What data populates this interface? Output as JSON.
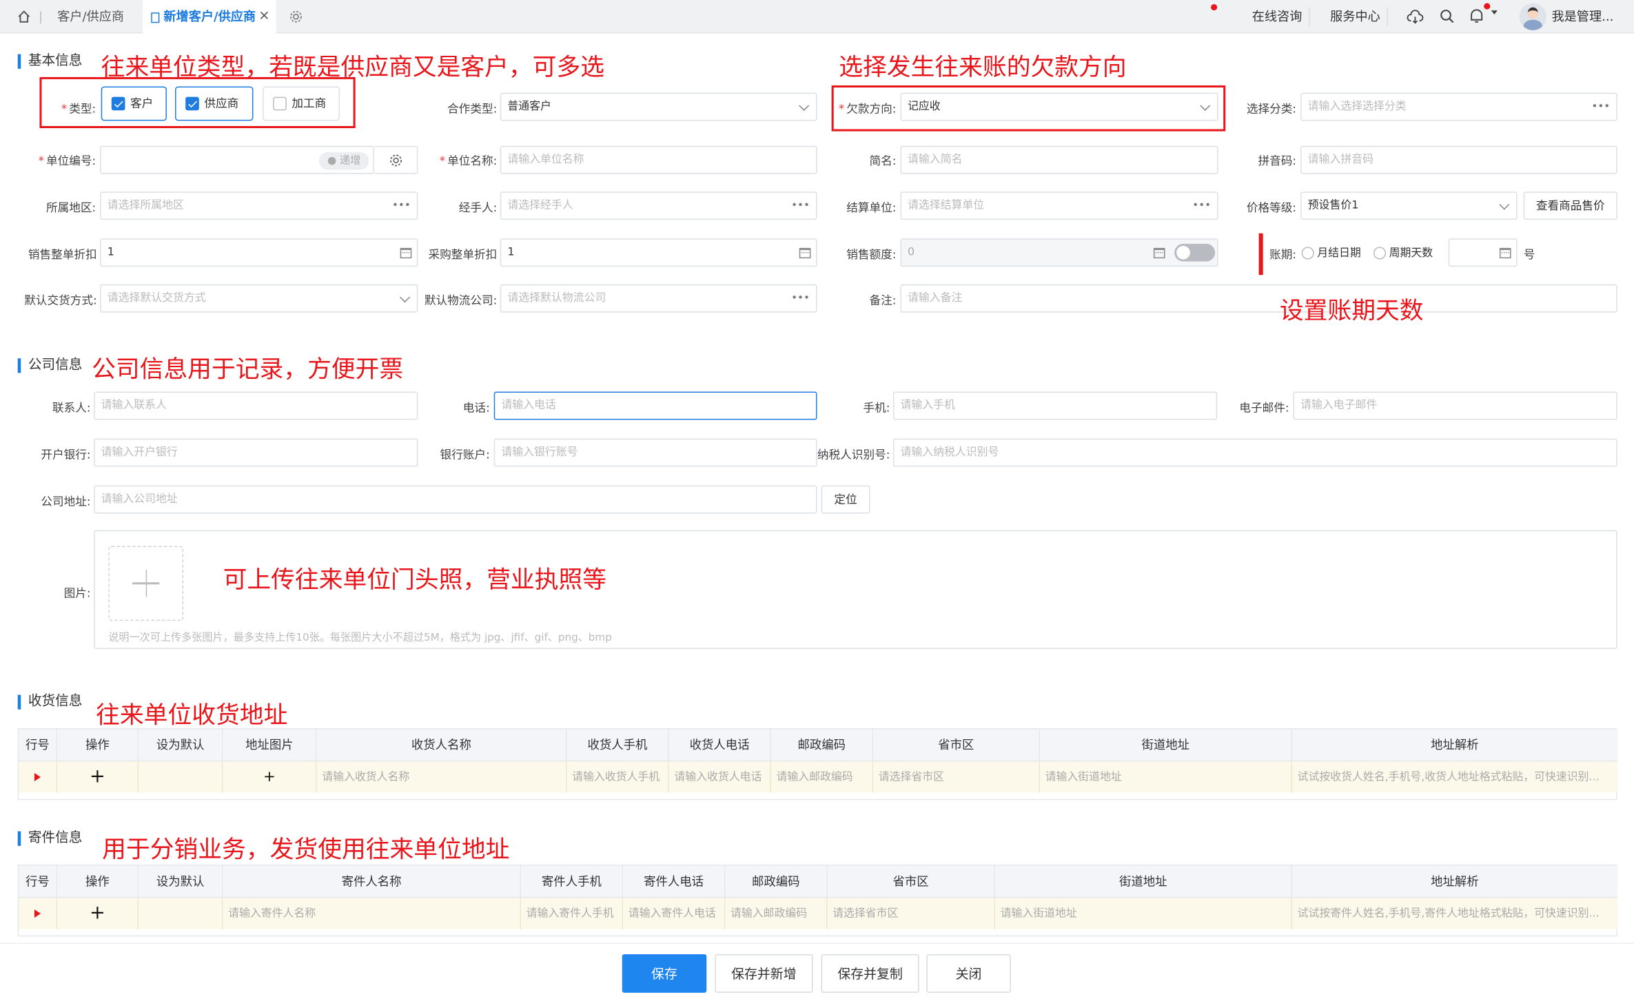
{
  "tabs": {
    "home_icon": "home-icon",
    "list": "客户/供应商",
    "active": "新增客户/供应商",
    "close": "×",
    "settings_icon": "gear-icon"
  },
  "header": {
    "online": "在线咨询",
    "service": "服务中心",
    "user": "我是管理..."
  },
  "basic": {
    "title": "基本信息",
    "type_label": "类型:",
    "type_options": [
      {
        "label": "客户",
        "checked": true
      },
      {
        "label": "供应商",
        "checked": true
      },
      {
        "label": "加工商",
        "checked": false
      }
    ],
    "coop_label": "合作类型:",
    "coop_value": "普通客户",
    "debt_label": "欠款方向:",
    "debt_value": "记应收",
    "cat_label": "选择分类:",
    "cat_ph": "请输入选择选择分类",
    "code_label": "单位编号:",
    "code_badge": "递增",
    "name_label": "单位名称:",
    "name_ph": "请输入单位名称",
    "short_label": "简名:",
    "short_ph": "请输入简名",
    "pinyin_label": "拼音码:",
    "pinyin_ph": "请输入拼音码",
    "region_label": "所属地区:",
    "region_ph": "请选择所属地区",
    "handler_label": "经手人:",
    "handler_ph": "请选择经手人",
    "settle_label": "结算单位:",
    "settle_ph": "请选择结算单位",
    "price_label": "价格等级:",
    "price_value": "预设售价1",
    "price_btn": "查看商品售价",
    "sale_disc_label": "销售整单折扣",
    "sale_disc_value": "1",
    "buy_disc_label": "采购整单折扣",
    "buy_disc_value": "1",
    "quota_label": "销售额度:",
    "quota_value": "0",
    "term_label": "账期:",
    "term_opt1": "月结日期",
    "term_opt2": "周期天数",
    "term_unit": "号",
    "delivery_label": "默认交货方式:",
    "delivery_ph": "请选择默认交货方式",
    "logistics_label": "默认物流公司:",
    "logistics_ph": "请选择默认物流公司",
    "remark_label": "备注:",
    "remark_ph": "请输入备注"
  },
  "company": {
    "title": "公司信息",
    "contact_label": "联系人:",
    "contact_ph": "请输入联系人",
    "phone_label": "电话:",
    "phone_ph": "请输入电话",
    "mobile_label": "手机:",
    "mobile_ph": "请输入手机",
    "email_label": "电子邮件:",
    "email_ph": "请输入电子邮件",
    "bank_label": "开户银行:",
    "bank_ph": "请输入开户银行",
    "account_label": "银行账户:",
    "account_ph": "请输入银行账号",
    "tax_label": "纳税人识别号:",
    "tax_ph": "请输入纳税人识别号",
    "addr_label": "公司地址:",
    "addr_ph": "请输入公司地址",
    "locate_btn": "定位",
    "image_label": "图片:",
    "image_note": "说明一次可上传多张图片，最多支持上传10张。每张图片大小不超过5M，格式为 jpg、jfif、gif、png、bmp"
  },
  "receive": {
    "title": "收货信息",
    "headers": [
      "行号",
      "操作",
      "设为默认",
      "地址图片",
      "收货人名称",
      "收货人手机",
      "收货人电话",
      "邮政编码",
      "省市区",
      "街道地址",
      "地址解析"
    ],
    "row": [
      "",
      "+",
      "",
      "+",
      "请输入收货人名称",
      "请输入收货人手机",
      "请输入收货人电话",
      "请输入邮政编码",
      "请选择省市区",
      "请输入街道地址",
      "试试按收货人姓名,手机号,收货人地址格式粘贴，可快速识别..."
    ]
  },
  "send": {
    "title": "寄件信息",
    "headers": [
      "行号",
      "操作",
      "设为默认",
      "寄件人名称",
      "寄件人手机",
      "寄件人电话",
      "邮政编码",
      "省市区",
      "街道地址",
      "地址解析"
    ],
    "row": [
      "",
      "+",
      "",
      "请输入寄件人名称",
      "请输入寄件人手机",
      "请输入寄件人电话",
      "请输入邮政编码",
      "请选择省市区",
      "请输入街道地址",
      "试试按寄件人姓名,手机号,寄件人地址格式粘贴，可快速识别..."
    ]
  },
  "annotations": {
    "a1": "往来单位类型，若既是供应商又是客户，可多选",
    "a2": "选择发生往来账的欠款方向",
    "a3": "设置账期天数",
    "a4": "公司信息用于记录，方便开票",
    "a5": "可上传往来单位门头照，营业执照等",
    "a6": "往来单位收货地址",
    "a7": "用于分销业务，发货使用往来单位地址"
  },
  "footer": {
    "save": "保存",
    "save_new": "保存并新增",
    "save_copy": "保存并复制",
    "close": "关闭"
  },
  "colors": {
    "accent": "#1f7de0",
    "annotation": "#e8161b",
    "row_highlight": "#fdf9ea"
  }
}
